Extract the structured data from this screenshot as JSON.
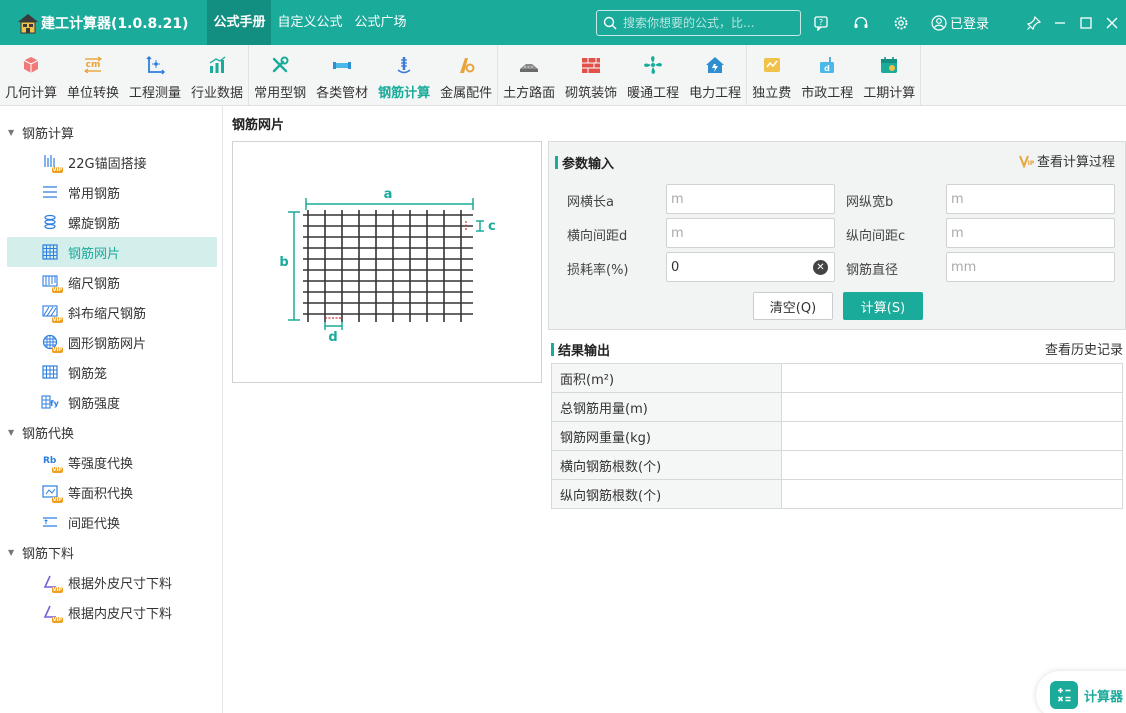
{
  "app": {
    "title": "建工计算器(1.0.8.21)",
    "accent_color": "#1aab9b",
    "nav_tabs": [
      {
        "label": "公式手册",
        "active": true
      },
      {
        "label": "自定义公式",
        "active": false
      },
      {
        "label": "公式广场",
        "active": false
      }
    ],
    "search_placeholder": "搜索你想要的公式，比...",
    "login_label": "已登录"
  },
  "toolbar": {
    "groups": [
      [
        {
          "label": "几何计算",
          "icon": "cube-icon"
        },
        {
          "label": "单位转换",
          "icon": "unit-convert-icon"
        },
        {
          "label": "工程测量",
          "icon": "axis-measure-icon"
        },
        {
          "label": "行业数据",
          "icon": "bar-chart-icon"
        }
      ],
      [
        {
          "label": "常用型钢",
          "icon": "wrench-icon"
        },
        {
          "label": "各类管材",
          "icon": "pipe-icon"
        },
        {
          "label": "钢筋计算",
          "icon": "rebar-icon",
          "active": true
        },
        {
          "label": "金属配件",
          "icon": "metal-fitting-icon"
        }
      ],
      [
        {
          "label": "土方路面",
          "icon": "road-icon"
        },
        {
          "label": "砌筑装饰",
          "icon": "brick-icon"
        },
        {
          "label": "暖通工程",
          "icon": "fan-icon"
        },
        {
          "label": "电力工程",
          "icon": "power-house-icon"
        }
      ],
      [
        {
          "label": "独立费",
          "icon": "fee-icon"
        },
        {
          "label": "市政工程",
          "icon": "municipal-icon"
        },
        {
          "label": "工期计算",
          "icon": "calendar-icon"
        }
      ]
    ]
  },
  "sidebar": {
    "groups": [
      {
        "label": "钢筋计算",
        "items": [
          {
            "label": "22G锚固搭接",
            "icon": "anchor-lap-icon",
            "vip": true
          },
          {
            "label": "常用钢筋",
            "icon": "rebar-lines-icon"
          },
          {
            "label": "螺旋钢筋",
            "icon": "spiral-icon"
          },
          {
            "label": "钢筋网片",
            "icon": "mesh-icon",
            "active": true
          },
          {
            "label": "缩尺钢筋",
            "icon": "taper-rebar-icon",
            "vip": true
          },
          {
            "label": "斜布缩尺钢筋",
            "icon": "oblique-rebar-icon",
            "vip": true
          },
          {
            "label": "圆形钢筋网片",
            "icon": "circle-mesh-icon",
            "vip": true
          },
          {
            "label": "钢筋笼",
            "icon": "cage-icon"
          },
          {
            "label": "钢筋强度",
            "icon": "strength-icon"
          }
        ]
      },
      {
        "label": "钢筋代换",
        "items": [
          {
            "label": "等强度代换",
            "icon": "equal-strength-icon",
            "vip": true
          },
          {
            "label": "等面积代换",
            "icon": "equal-area-icon",
            "vip": true
          },
          {
            "label": "间距代换",
            "icon": "spacing-icon"
          }
        ]
      },
      {
        "label": "钢筋下料",
        "items": [
          {
            "label": "根据外皮尺寸下料",
            "icon": "outer-size-icon",
            "vip": true
          },
          {
            "label": "根据内皮尺寸下料",
            "icon": "inner-size-icon",
            "vip": true
          }
        ]
      }
    ]
  },
  "main": {
    "page_title": "钢筋网片",
    "diagram": {
      "label_a": "a",
      "label_b": "b",
      "label_c": "c",
      "label_d": "d"
    },
    "params": {
      "section_title": "参数输入",
      "calc_process_label": "查看计算过程",
      "fields": [
        {
          "label": "网横长a",
          "placeholder": "m",
          "value": ""
        },
        {
          "label": "网纵宽b",
          "placeholder": "m",
          "value": ""
        },
        {
          "label": "横向间距d",
          "placeholder": "m",
          "value": ""
        },
        {
          "label": "纵向间距c",
          "placeholder": "m",
          "value": ""
        },
        {
          "label": "损耗率(%)",
          "placeholder": "",
          "value": "0"
        },
        {
          "label": "钢筋直径",
          "placeholder": "mm",
          "value": ""
        }
      ],
      "clear_button": "清空(Q)",
      "calc_button": "计算(S)"
    },
    "results": {
      "section_title": "结果输出",
      "history_label": "查看历史记录",
      "rows": [
        {
          "label": "面积(m²)",
          "value": ""
        },
        {
          "label": "总钢筋用量(m)",
          "value": ""
        },
        {
          "label": "钢筋网重量(kg)",
          "value": ""
        },
        {
          "label": "横向钢筋根数(个)",
          "value": ""
        },
        {
          "label": "纵向钢筋根数(个)",
          "value": ""
        }
      ]
    }
  },
  "floating_calculator": {
    "label": "计算器"
  }
}
